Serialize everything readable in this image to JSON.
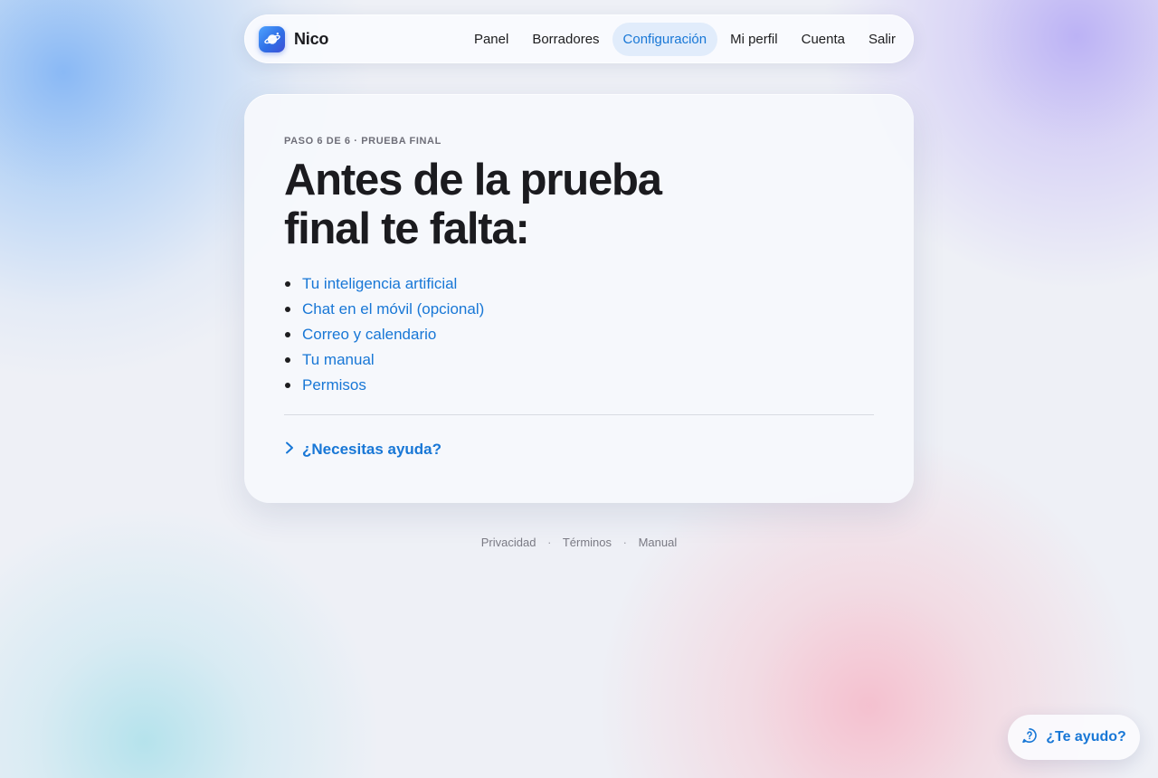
{
  "nav": {
    "brand": "Nico",
    "logo_icon": "planet-icon",
    "links": [
      {
        "label": "Panel",
        "active": false
      },
      {
        "label": "Borradores",
        "active": false
      },
      {
        "label": "Configuración",
        "active": true
      },
      {
        "label": "Mi perfil",
        "active": false
      },
      {
        "label": "Cuenta",
        "active": false
      },
      {
        "label": "Salir",
        "active": false
      }
    ]
  },
  "card": {
    "eyebrow": "PASO 6 DE 6 · PRUEBA FINAL",
    "title": "Antes de la prueba final te falta:",
    "steps": [
      "Tu inteligencia artificial",
      "Chat en el móvil (opcional)",
      "Correo y calendario",
      "Tu manual",
      "Permisos"
    ],
    "help_label": "¿Necesitas ayuda?",
    "help_icon": "chevron-right-icon"
  },
  "footer": {
    "links": [
      "Privacidad",
      "Términos",
      "Manual"
    ],
    "separator": "·"
  },
  "fab": {
    "label": "¿Te ayudo?",
    "icon": "help-chat-icon"
  },
  "colors": {
    "accent": "#1877d6",
    "active_bg": "#e1ecfb",
    "text": "#1d1d1f",
    "muted": "#6e6e78"
  }
}
